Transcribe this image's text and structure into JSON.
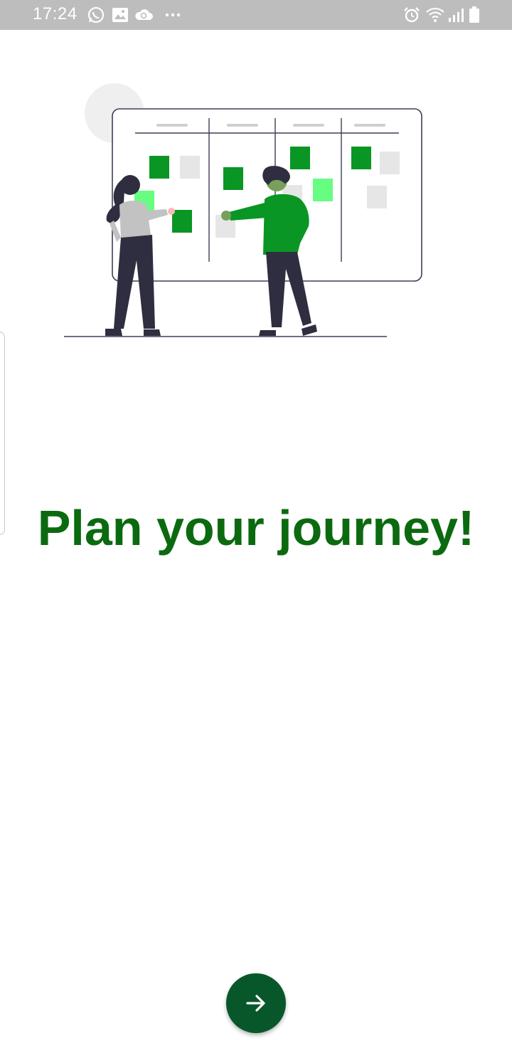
{
  "status_bar": {
    "time": "17:24",
    "left_icons": [
      "whatsapp-icon",
      "gallery-icon",
      "cloud-sync-icon",
      "more-dots-icon"
    ],
    "right_icons": [
      "alarm-icon",
      "wifi-icon",
      "signal-icon",
      "battery-icon"
    ]
  },
  "onboarding": {
    "illustration": "kanban-board-people-illustration",
    "headline": "Plan your journey!",
    "next_button_icon": "arrow-right-icon"
  },
  "colors": {
    "status_bar_bg": "#bdbdbd",
    "headline": "#0b6a10",
    "accent_green": "#099624",
    "light_green": "#66fd81",
    "next_button": "#08572a"
  }
}
